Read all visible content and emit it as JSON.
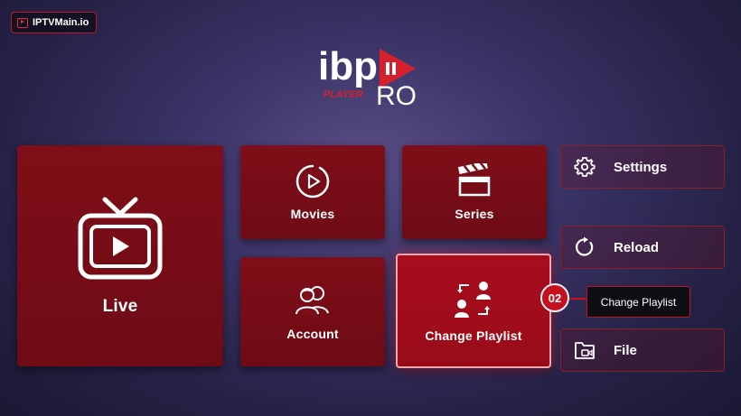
{
  "brand": {
    "badge_text": "IPTVMain.io",
    "logo_text": "ibp",
    "logo_sub": "PLAYER",
    "logo_pro": "RO"
  },
  "tiles": {
    "live": {
      "label": "Live",
      "icon": "tv-play-icon"
    },
    "movies": {
      "label": "Movies",
      "icon": "play-circle-icon"
    },
    "series": {
      "label": "Series",
      "icon": "clapperboard-icon"
    },
    "account": {
      "label": "Account",
      "icon": "users-icon"
    },
    "change_playlist": {
      "label": "Change Playlist",
      "icon": "swap-users-icon"
    }
  },
  "side_menu": {
    "settings": {
      "label": "Settings",
      "icon": "gear-icon"
    },
    "reload": {
      "label": "Reload",
      "icon": "reload-icon"
    },
    "file": {
      "label": "File",
      "icon": "folder-video-icon"
    }
  },
  "annotation": {
    "step": "02",
    "tooltip": "Change Playlist"
  },
  "colors": {
    "accent": "#c4101f",
    "tile": "#7f0e18",
    "tile_active": "#a80d1d"
  }
}
